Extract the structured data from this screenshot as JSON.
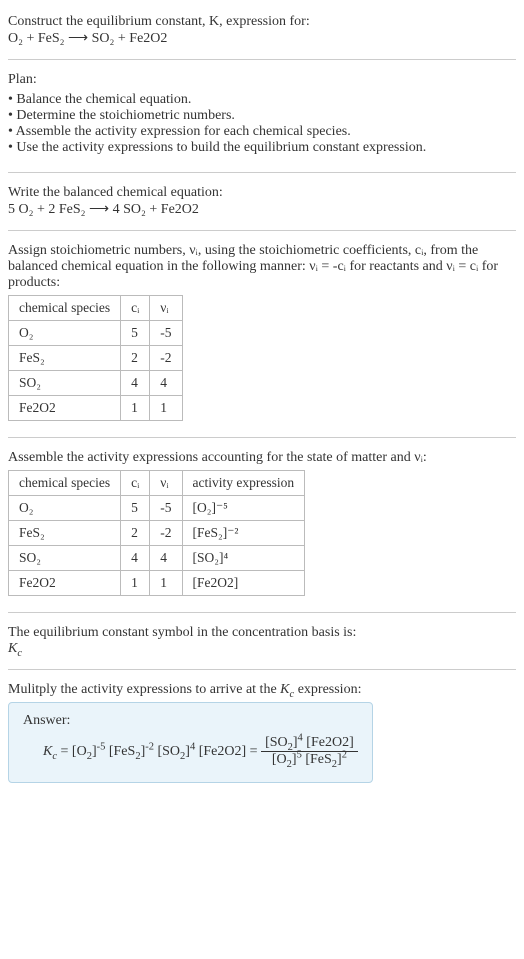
{
  "prompt": {
    "line1": "Construct the equilibrium constant, K, expression for:",
    "eq": "O₂ + FeS₂ ⟶ SO₂ + Fe2O2"
  },
  "plan": {
    "title": "Plan:",
    "items": [
      "Balance the chemical equation.",
      "Determine the stoichiometric numbers.",
      "Assemble the activity expression for each chemical species.",
      "Use the activity expressions to build the equilibrium constant expression."
    ]
  },
  "balanced": {
    "title": "Write the balanced chemical equation:",
    "eq": "5 O₂ + 2 FeS₂ ⟶ 4 SO₂ + Fe2O2"
  },
  "stoich": {
    "intro": "Assign stoichiometric numbers, νᵢ, using the stoichiometric coefficients, cᵢ, from the balanced chemical equation in the following manner: νᵢ = -cᵢ for reactants and νᵢ = cᵢ for products:",
    "headers": [
      "chemical species",
      "cᵢ",
      "νᵢ"
    ],
    "rows": [
      [
        "O₂",
        "5",
        "-5"
      ],
      [
        "FeS₂",
        "2",
        "-2"
      ],
      [
        "SO₂",
        "4",
        "4"
      ],
      [
        "Fe2O2",
        "1",
        "1"
      ]
    ]
  },
  "activity": {
    "intro": "Assemble the activity expressions accounting for the state of matter and νᵢ:",
    "headers": [
      "chemical species",
      "cᵢ",
      "νᵢ",
      "activity expression"
    ],
    "rows": [
      [
        "O₂",
        "5",
        "-5",
        "[O₂]⁻⁵"
      ],
      [
        "FeS₂",
        "2",
        "-2",
        "[FeS₂]⁻²"
      ],
      [
        "SO₂",
        "4",
        "4",
        "[SO₂]⁴"
      ],
      [
        "Fe2O2",
        "1",
        "1",
        "[Fe2O2]"
      ]
    ]
  },
  "symbol": {
    "line1": "The equilibrium constant symbol in the concentration basis is:",
    "line2": "K_c"
  },
  "final": {
    "intro": "Mulitply the activity expressions to arrive at the K_c expression:",
    "answer_label": "Answer:",
    "lhs": "K_c = [O₂]⁻⁵ [FeS₂]⁻² [SO₂]⁴ [Fe2O2] =",
    "frac_num": "[SO₂]⁴ [Fe2O2]",
    "frac_den": "[O₂]⁵ [FeS₂]²"
  },
  "chart_data": {
    "type": "table",
    "title": "Stoichiometric numbers",
    "columns": [
      "chemical species",
      "c_i",
      "nu_i"
    ],
    "rows": [
      {
        "chemical species": "O2",
        "c_i": 5,
        "nu_i": -5
      },
      {
        "chemical species": "FeS2",
        "c_i": 2,
        "nu_i": -2
      },
      {
        "chemical species": "SO2",
        "c_i": 4,
        "nu_i": 4
      },
      {
        "chemical species": "Fe2O2",
        "c_i": 1,
        "nu_i": 1
      }
    ]
  }
}
